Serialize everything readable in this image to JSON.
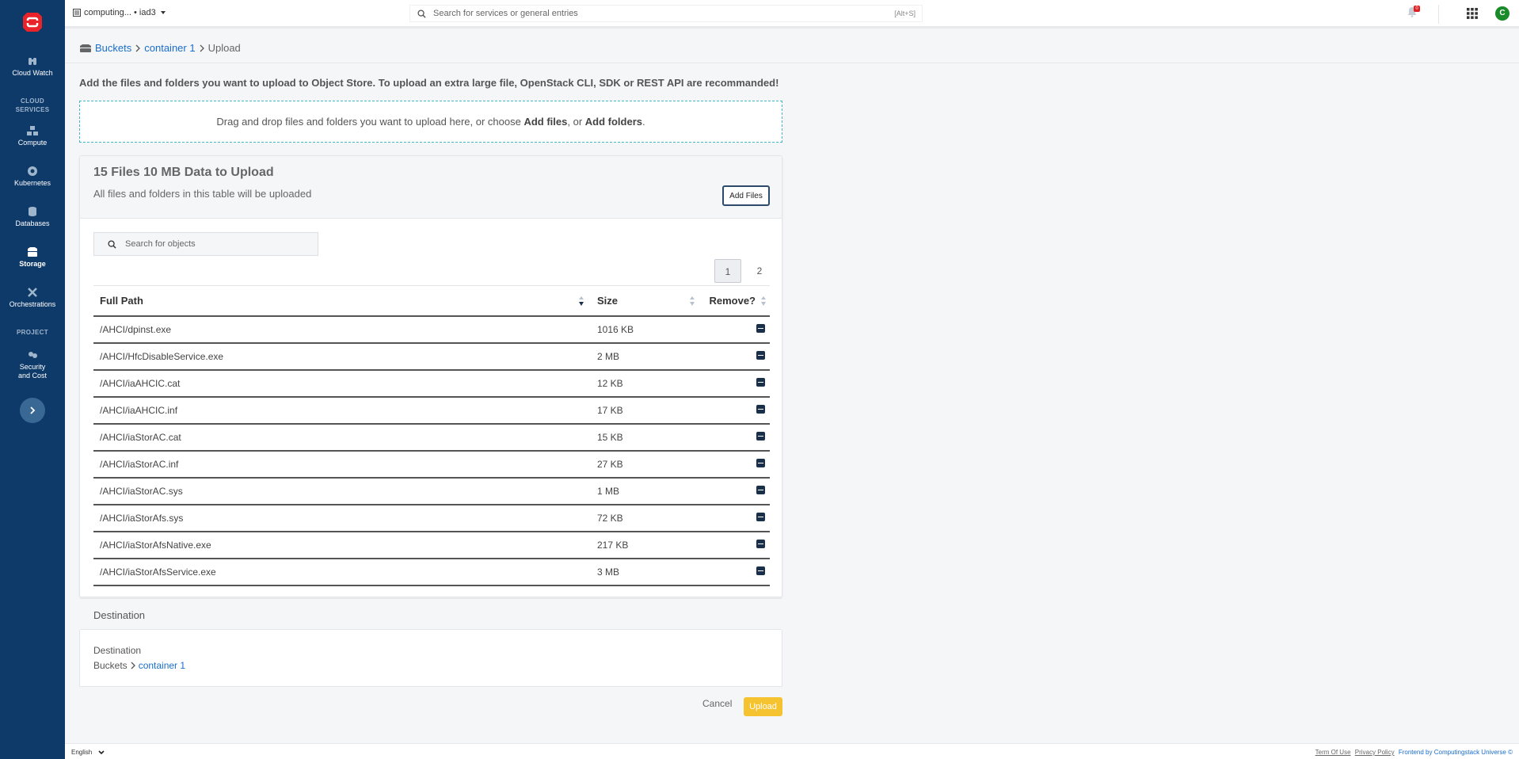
{
  "colors": {
    "sidebar": "#0e3a6a",
    "accent_link": "#1a6dcc",
    "upload_button": "#f5c230",
    "dropzone_border": "#3fb8c8",
    "avatar": "#1a8a2a",
    "badge": "#e02020"
  },
  "sidebar": {
    "items": [
      {
        "label": "Cloud Watch",
        "icon": "binoculars-icon"
      },
      {
        "label": "Compute",
        "icon": "compute-icon"
      },
      {
        "label": "Kubernetes",
        "icon": "kubernetes-icon"
      },
      {
        "label": "Databases",
        "icon": "database-icon"
      },
      {
        "label": "Storage",
        "icon": "storage-icon",
        "active": true
      },
      {
        "label": "Orchestrations",
        "icon": "orchestration-icon"
      },
      {
        "label": "Security and Cost",
        "icon": "security-icon"
      }
    ],
    "sections": {
      "cloud_services_1": "CLOUD",
      "cloud_services_2": "SERVICES",
      "project": "PROJECT"
    }
  },
  "topbar": {
    "project": "computing... • iad3",
    "search_placeholder": "Search for services or general entries",
    "search_hint": "[Alt+S]",
    "notification_count": "0",
    "avatar_initial": "C"
  },
  "breadcrumb": {
    "root": "Buckets",
    "container": "container 1",
    "current": "Upload"
  },
  "main": {
    "intro": "Add the files and folders you want to upload to Object Store. To upload an extra large file, OpenStack CLI, SDK or REST API are recommanded!",
    "dropzone": {
      "text": "Drag and drop files and folders you want to upload here, or choose ",
      "add_files": "Add files",
      "sep": ", or ",
      "add_folders": "Add folders",
      "end": "."
    }
  },
  "upload_card": {
    "title": "15 Files 10 MB Data to Upload",
    "subtitle": "All files and folders in this table will be uploaded",
    "add_files_label": "Add Files",
    "search_placeholder": "Search for objects",
    "pages": [
      "1",
      "2"
    ],
    "columns": {
      "path": "Full Path",
      "size": "Size",
      "remove": "Remove?"
    },
    "rows": [
      {
        "path": "/AHCI/dpinst.exe",
        "size": "1016 KB"
      },
      {
        "path": "/AHCI/HfcDisableService.exe",
        "size": "2 MB"
      },
      {
        "path": "/AHCI/iaAHCIC.cat",
        "size": "12 KB"
      },
      {
        "path": "/AHCI/iaAHCIC.inf",
        "size": "17 KB"
      },
      {
        "path": "/AHCI/iaStorAC.cat",
        "size": "15 KB"
      },
      {
        "path": "/AHCI/iaStorAC.inf",
        "size": "27 KB"
      },
      {
        "path": "/AHCI/iaStorAC.sys",
        "size": "1 MB"
      },
      {
        "path": "/AHCI/iaStorAfs.sys",
        "size": "72 KB"
      },
      {
        "path": "/AHCI/iaStorAfsNative.exe",
        "size": "217 KB"
      },
      {
        "path": "/AHCI/iaStorAfsService.exe",
        "size": "3 MB"
      }
    ]
  },
  "destination": {
    "header": "Destination",
    "label": "Destination",
    "root": "Buckets",
    "container": "container 1"
  },
  "actions": {
    "cancel": "Cancel",
    "upload": "Upload"
  },
  "footer": {
    "language": "English",
    "terms": "Term Of Use",
    "privacy": "Privacy Policy",
    "credit": "Frontend by Computingstack Universe ©"
  }
}
